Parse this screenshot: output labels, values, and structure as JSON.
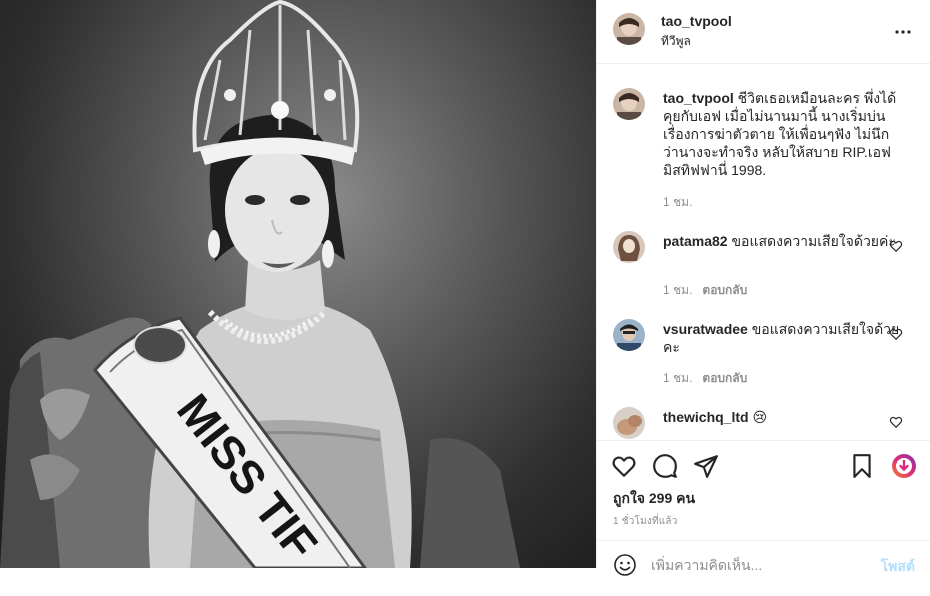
{
  "header": {
    "username": "tao_tvpool",
    "location": "ทีวีพูล"
  },
  "caption": {
    "username": "tao_tvpool",
    "text": "ชีวิตเธอเหมือนละคร พึ่งได้คุยกับเอฟ เมื่อไม่นานมานี้ นางเริ่มบ่น เรื่องการฆ่าตัวตาย ให้เพื่อนๆฟัง ไม่นึกว่านางจะทำจริง หลับให้สบาย RIP.เอฟ มิสทิฟฟานี่ 1998.",
    "time": "1 ชม."
  },
  "comments": [
    {
      "username": "patama82",
      "text": "ขอแสดงความเสียใจด้วยค่ะ",
      "time": "1 ชม.",
      "reply": "ตอบกลับ"
    },
    {
      "username": "vsuratwadee",
      "text": "ขอแสดงความเสียใจด้วยคะ",
      "time": "1 ชม.",
      "reply": "ตอบกลับ"
    },
    {
      "username": "thewichq_ltd",
      "text": "😢",
      "time": "",
      "reply": ""
    }
  ],
  "likes": "ถูกใจ 299 คน",
  "posted_time": "1 ชั่วโมงที่แล้ว",
  "add_comment": {
    "placeholder": "เพิ่มความคิดเห็น...",
    "post_label": "โพสต์"
  },
  "photo": {
    "sash_text": "MISS TIF"
  },
  "colors": {
    "text": "#262626",
    "secondary": "#8e8e8e",
    "border": "#efefef",
    "post_button_disabled": "#b2dffc",
    "save_accent": "#e1306c"
  },
  "icons": [
    "more-icon",
    "heart-icon",
    "comment-icon",
    "share-icon",
    "bookmark-icon",
    "igtv-save-icon",
    "emoji-icon"
  ]
}
